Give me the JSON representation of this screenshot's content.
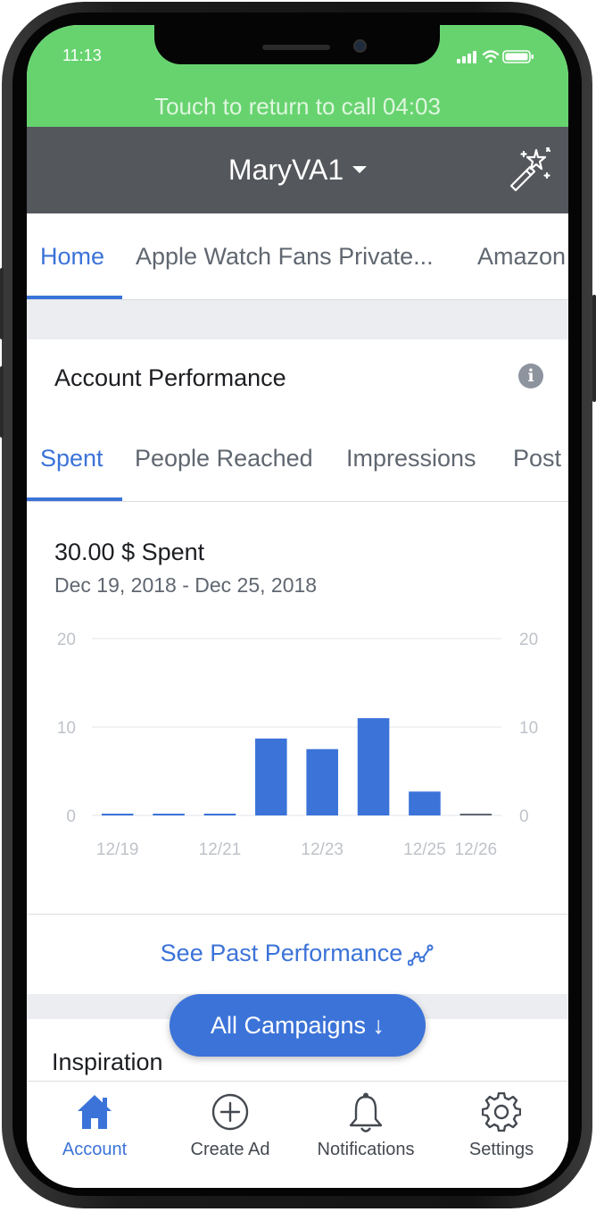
{
  "status_bar": {
    "time": "11:13"
  },
  "call_bar": {
    "text": "Touch to return to call 04:03"
  },
  "header": {
    "account_name": "MaryVA1"
  },
  "page_tabs": [
    {
      "label": "Home",
      "active": true
    },
    {
      "label": "Apple Watch Fans Private...",
      "active": false
    },
    {
      "label": "Amazon",
      "active": false
    }
  ],
  "performance": {
    "title": "Account Performance",
    "tabs": [
      {
        "label": "Spent",
        "active": true
      },
      {
        "label": "People Reached",
        "active": false
      },
      {
        "label": "Impressions",
        "active": false
      },
      {
        "label": "Post",
        "active": false
      }
    ],
    "summary_value": "30.00 $ Spent",
    "summary_range": "Dec 19, 2018 - Dec 25, 2018",
    "see_past_label": "See Past Performance"
  },
  "chart_data": {
    "type": "bar",
    "categories": [
      "12/19",
      "12/20",
      "12/21",
      "12/22",
      "12/23",
      "12/24",
      "12/25",
      "12/26"
    ],
    "x_tick_labels": [
      "12/19",
      "",
      "12/21",
      "",
      "12/23",
      "",
      "12/25",
      "12/26"
    ],
    "values": [
      0.1,
      0.1,
      0.1,
      8.7,
      7.5,
      11,
      2.7,
      0.1
    ],
    "ylim": [
      0,
      20
    ],
    "y_ticks": [
      0,
      10,
      20
    ],
    "grid": true,
    "colors": {
      "bar": "#3b73d8",
      "last_bar": "#606770"
    }
  },
  "floating_button": {
    "label": "All Campaigns ↓"
  },
  "inspiration": {
    "title": "Inspiration"
  },
  "bottom_nav": [
    {
      "label": "Account",
      "icon": "home-icon",
      "active": true
    },
    {
      "label": "Create Ad",
      "icon": "plus-circle-icon",
      "active": false
    },
    {
      "label": "Notifications",
      "icon": "bell-icon",
      "active": false
    },
    {
      "label": "Settings",
      "icon": "gear-icon",
      "active": false
    }
  ],
  "colors": {
    "accent": "#3b73d8",
    "call_bar": "#67d36f",
    "header": "#54575c"
  }
}
